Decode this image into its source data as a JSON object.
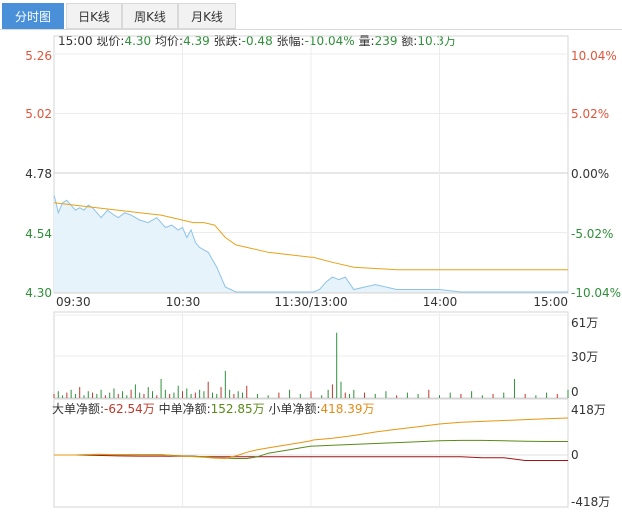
{
  "tabs": [
    {
      "label": "分时图",
      "active": true
    },
    {
      "label": "日K线",
      "active": false
    },
    {
      "label": "周K线",
      "active": false
    },
    {
      "label": "月K线",
      "active": false
    }
  ],
  "info": {
    "time": "15:00",
    "price_label": "现价:",
    "price": "4.30",
    "avg_label": "均价:",
    "avg": "4.39",
    "change_label": "张跌:",
    "change": "-0.48",
    "pct_label": "张幅:",
    "pct": "-10.04%",
    "vol_label": "量:",
    "vol": "239",
    "amt_label": "额:",
    "amt": "10.3万"
  },
  "price_axis": {
    "left_labels": [
      "5.26",
      "5.02",
      "4.78",
      "4.54",
      "4.30"
    ],
    "right_labels": [
      "10.04%",
      "5.02%",
      "0.00%",
      "-5.02%",
      "-10.04%"
    ],
    "colors": {
      "up": "#e0553a",
      "mid": "#333333",
      "down": "#2f8f3a"
    }
  },
  "time_labels": [
    "09:30",
    "10:30",
    "11:30/13:00",
    "14:00",
    "15:00"
  ],
  "volume_axis": {
    "labels": [
      "61万",
      "30万",
      "0"
    ],
    "max": 61
  },
  "flow": {
    "big_label": "大单净额:",
    "big_value": "-62.54万",
    "mid_label": "中单净额:",
    "mid_value": "152.85万",
    "small_label": "小单净额:",
    "small_value": "418.39万",
    "axis_labels": [
      "418万",
      "0",
      "-418万"
    ],
    "max": 418,
    "colors": {
      "big": "#a31212",
      "mid": "#5a8a1a",
      "small": "#e8950f"
    }
  },
  "chart_data": {
    "type": "line",
    "price": {
      "ylim": [
        4.3,
        5.26
      ],
      "prev_close": 4.78,
      "x_minutes": [
        0,
        1,
        2,
        4,
        6,
        8,
        10,
        12,
        14,
        16,
        18,
        20,
        22,
        25,
        28,
        30,
        33,
        36,
        40,
        44,
        48,
        52,
        55,
        58,
        60,
        62,
        64,
        66,
        68,
        72,
        76,
        80,
        85,
        90,
        95,
        100,
        105,
        110,
        115,
        120,
        121,
        124,
        127,
        130,
        133,
        136,
        140,
        150,
        160,
        170,
        180,
        190,
        200,
        210,
        220,
        230,
        240
      ],
      "price": [
        4.69,
        4.66,
        4.62,
        4.66,
        4.67,
        4.65,
        4.63,
        4.64,
        4.63,
        4.65,
        4.64,
        4.62,
        4.6,
        4.63,
        4.61,
        4.6,
        4.62,
        4.61,
        4.59,
        4.58,
        4.6,
        4.56,
        4.57,
        4.55,
        4.56,
        4.52,
        4.55,
        4.5,
        4.48,
        4.46,
        4.4,
        4.32,
        4.3,
        4.3,
        4.3,
        4.3,
        4.3,
        4.3,
        4.3,
        4.3,
        4.3,
        4.31,
        4.34,
        4.36,
        4.35,
        4.36,
        4.31,
        4.33,
        4.31,
        4.31,
        4.31,
        4.3,
        4.3,
        4.3,
        4.3,
        4.3,
        4.3
      ],
      "avg_x": [
        0,
        10,
        20,
        30,
        40,
        50,
        55,
        60,
        65,
        70,
        75,
        80,
        85,
        90,
        100,
        110,
        120,
        121,
        130,
        140,
        160,
        180,
        200,
        220,
        240
      ],
      "avg": [
        4.66,
        4.65,
        4.64,
        4.63,
        4.62,
        4.61,
        4.6,
        4.59,
        4.58,
        4.58,
        4.57,
        4.52,
        4.49,
        4.48,
        4.46,
        4.45,
        4.44,
        4.44,
        4.42,
        4.4,
        4.39,
        4.39,
        4.39,
        4.39,
        4.39
      ]
    },
    "volume": {
      "unit": "万",
      "x_minutes": [
        0,
        2,
        4,
        6,
        8,
        10,
        12,
        14,
        16,
        18,
        20,
        22,
        24,
        26,
        28,
        30,
        32,
        34,
        36,
        38,
        40,
        42,
        44,
        46,
        48,
        50,
        52,
        54,
        56,
        58,
        60,
        62,
        64,
        66,
        68,
        70,
        72,
        74,
        76,
        78,
        80,
        82,
        84,
        86,
        88,
        90,
        95,
        100,
        105,
        110,
        115,
        120,
        125,
        128,
        130,
        132,
        134,
        136,
        138,
        140,
        145,
        150,
        155,
        160,
        165,
        170,
        175,
        180,
        185,
        190,
        195,
        200,
        205,
        210,
        215,
        220,
        225,
        230,
        235,
        240
      ],
      "values": [
        3,
        5,
        2,
        4,
        6,
        3,
        8,
        2,
        5,
        4,
        3,
        6,
        2,
        4,
        7,
        3,
        5,
        2,
        6,
        10,
        4,
        3,
        8,
        5,
        2,
        14,
        6,
        3,
        4,
        9,
        5,
        7,
        3,
        4,
        6,
        5,
        12,
        4,
        3,
        8,
        20,
        6,
        3,
        5,
        4,
        9,
        3,
        2,
        4,
        6,
        3,
        5,
        2,
        6,
        10,
        48,
        12,
        4,
        3,
        6,
        4,
        3,
        5,
        2,
        4,
        3,
        6,
        2,
        4,
        3,
        5,
        2,
        3,
        4,
        14,
        3,
        2,
        4,
        3,
        6
      ],
      "colors": [
        "#2f8f3a",
        "#c0392b"
      ]
    },
    "flow": {
      "unit": "万",
      "x_minutes": [
        0,
        10,
        20,
        30,
        40,
        50,
        55,
        60,
        65,
        70,
        75,
        80,
        85,
        90,
        95,
        100,
        105,
        110,
        115,
        120,
        121,
        130,
        140,
        150,
        160,
        170,
        180,
        190,
        200,
        210,
        220,
        230,
        240
      ],
      "big": [
        0,
        0,
        -5,
        -10,
        -12,
        -12,
        -15,
        -15,
        -15,
        -20,
        -20,
        -20,
        -20,
        -20,
        -20,
        -20,
        -20,
        -20,
        -20,
        -20,
        -20,
        -20,
        -20,
        -20,
        -20,
        -20,
        -20,
        -20,
        -30,
        -30,
        -62.54,
        -62.54,
        -62.54
      ],
      "mid": [
        0,
        0,
        5,
        5,
        5,
        5,
        -5,
        -10,
        -15,
        -20,
        -30,
        -35,
        -40,
        -40,
        -20,
        20,
        40,
        60,
        80,
        100,
        100,
        110,
        120,
        130,
        140,
        150,
        160,
        165,
        165,
        160,
        155,
        153,
        152.85
      ],
      "small": [
        0,
        0,
        8,
        5,
        5,
        5,
        -8,
        -12,
        -18,
        -25,
        -35,
        -40,
        -10,
        30,
        60,
        80,
        100,
        120,
        140,
        160,
        170,
        190,
        220,
        260,
        290,
        320,
        350,
        370,
        380,
        390,
        400,
        410,
        418.39
      ]
    }
  }
}
